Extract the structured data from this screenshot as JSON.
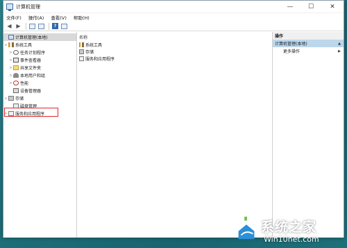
{
  "window": {
    "title": "计算机管理",
    "controls": {
      "minimize": "—",
      "maximize": "☐",
      "close": "✕"
    }
  },
  "menubar": {
    "items": [
      "文件(F)",
      "操作(A)",
      "查看(V)",
      "帮助(H)"
    ]
  },
  "tree": {
    "root": "计算机管理(本地)",
    "system_tools": "系统工具",
    "task_scheduler": "任务计划程序",
    "event_viewer": "事件查看器",
    "shared_folders": "共享文件夹",
    "local_users": "本地用户和组",
    "performance": "性能",
    "device_manager": "设备管理器",
    "storage": "存储",
    "disk_management": "磁盘管理",
    "services_apps": "服务和应用程序"
  },
  "main": {
    "column_header": "名称",
    "rows": [
      "系统工具",
      "存储",
      "服务和应用程序"
    ]
  },
  "actions": {
    "header": "操作",
    "selected": "计算机管理(本地)",
    "more": "更多操作"
  },
  "watermark": {
    "title": "系统之家",
    "url": "Win10net.com"
  }
}
